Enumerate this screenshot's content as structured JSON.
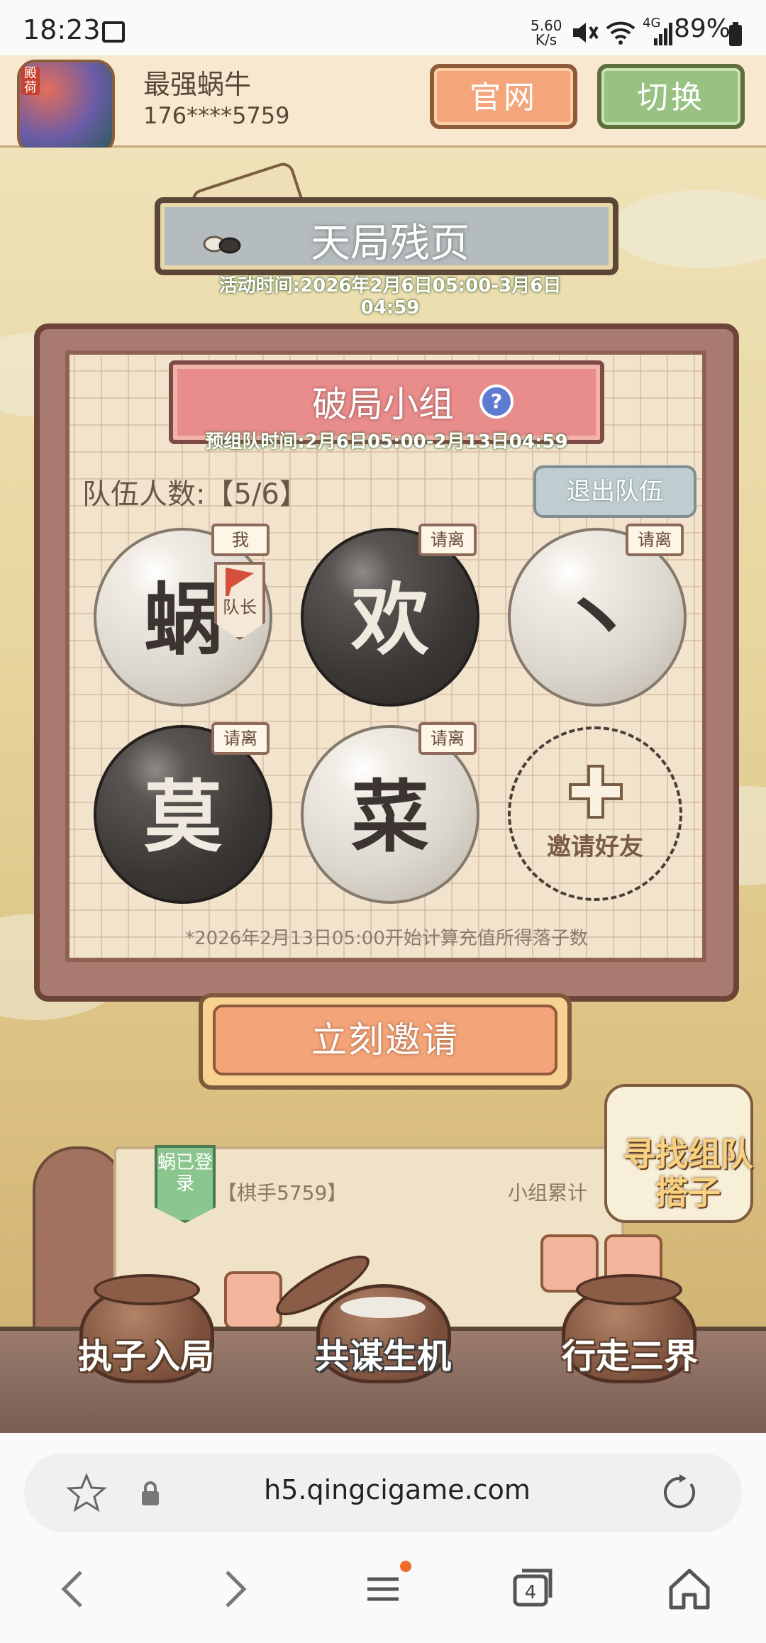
{
  "status_bar": {
    "time": "18:23",
    "net_speed_top": "5.60",
    "net_speed_bottom": "K/s",
    "network": "4G",
    "battery": "89%"
  },
  "header": {
    "icon_tag": "殿荷",
    "user_name": "最强蜗牛",
    "user_phone": "176****5759",
    "official_btn": "官网",
    "switch_btn": "切换"
  },
  "event": {
    "title": "天局残页",
    "time": "活动时间:2026年2月6日05:00-3月6日04:59"
  },
  "team": {
    "title": "破局小组",
    "help": "?",
    "pre_team_time": "预组队时间:2月6日05:00-2月13日04:59",
    "count": "队伍人数:【5/6】",
    "leave_btn": "退出队伍",
    "members": [
      {
        "char": "蜗",
        "color": "white",
        "chip": "我",
        "leader": "队长"
      },
      {
        "char": "欢",
        "color": "black",
        "chip": "请离"
      },
      {
        "char": "丶",
        "color": "white",
        "chip": "请离"
      },
      {
        "char": "莫",
        "color": "black",
        "chip": "请离"
      },
      {
        "char": "菜",
        "color": "white",
        "chip": "请离"
      }
    ],
    "invite_slot": "邀请好友",
    "notice": "*2026年2月13日05:00开始计算充值所得落子数",
    "invite_now": "立刻邀请"
  },
  "bottom": {
    "login_badge": "蜗已登录",
    "player": "【棋手5759】",
    "accum": "小组累计",
    "find_partner": "寻找组队搭子",
    "nav": [
      "执子入局",
      "共谋生机",
      "行走三界"
    ]
  },
  "browser": {
    "url": "h5.qingcigame.com",
    "tabs_count": "4"
  },
  "colors": {
    "accent_orange": "#f4a67a",
    "accent_green": "#98c282",
    "board": "#f1e3cc",
    "frame": "#a87a70"
  }
}
